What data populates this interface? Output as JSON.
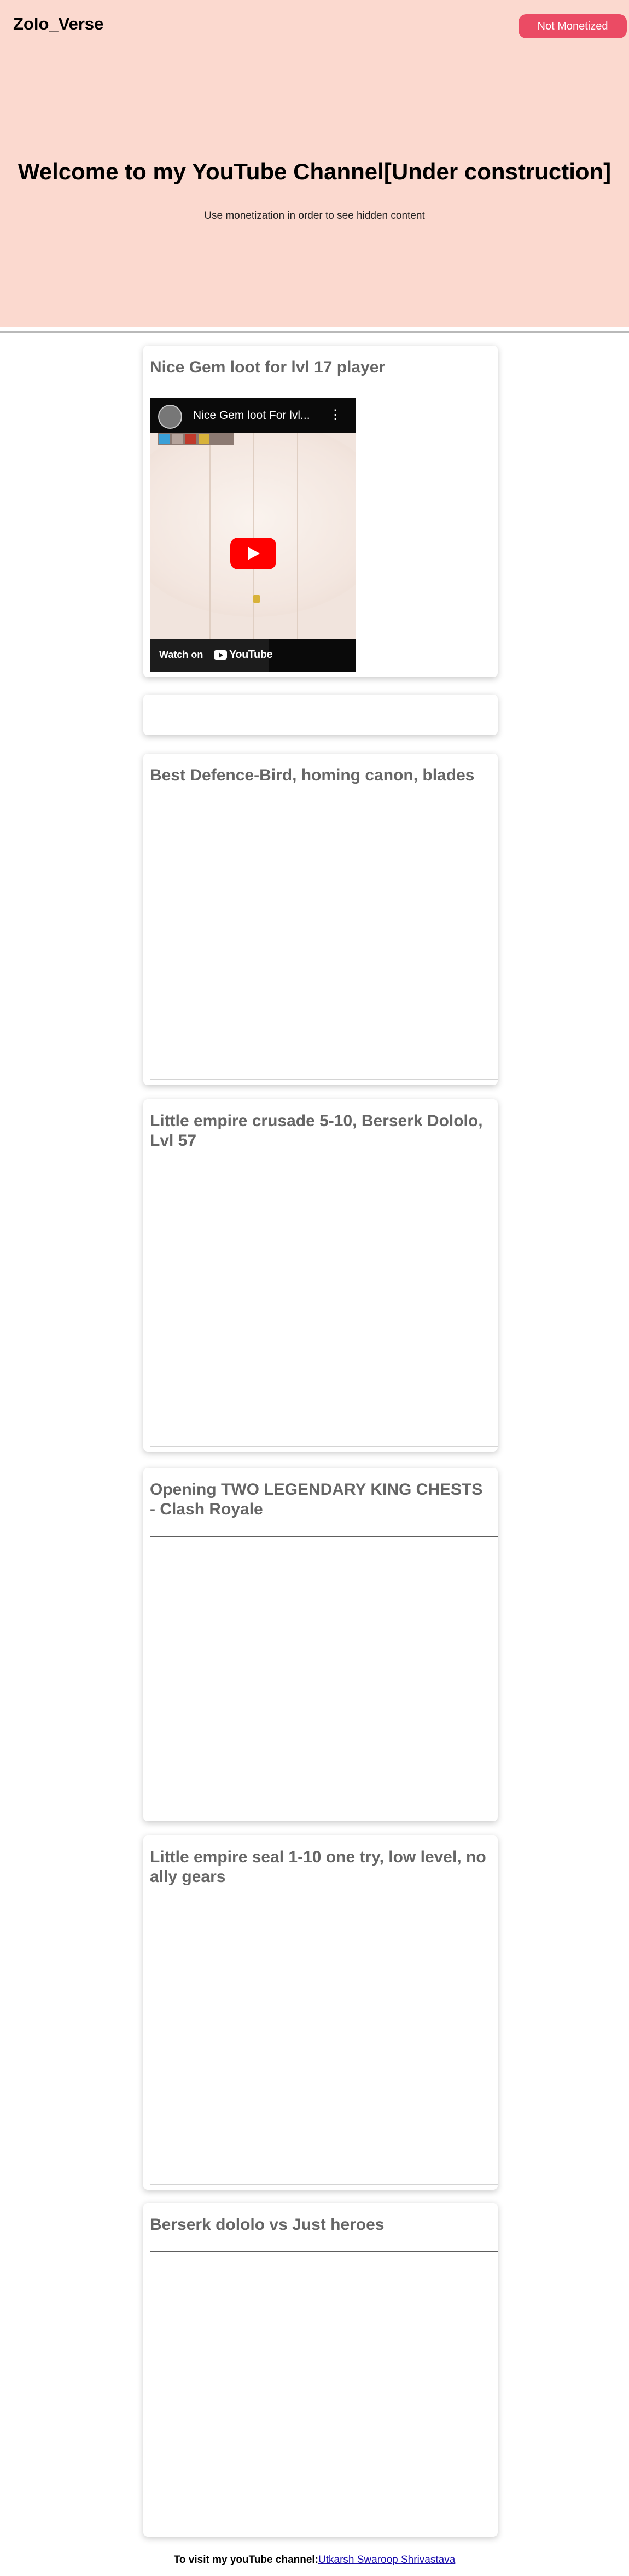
{
  "header": {
    "brand": "Zolo_Verse",
    "status_button": "Not Monetized"
  },
  "hero": {
    "title": "Welcome to my YouTube Channel[Under construction]",
    "subtitle": "Use monetization in order to see hidden content"
  },
  "videos": [
    {
      "title": "Nice Gem loot for lvl 17 player",
      "player": {
        "video_title": "Nice Gem loot For lvl...",
        "watch_on": "Watch on",
        "brand": "YouTube"
      }
    },
    {
      "title": ""
    },
    {
      "title": "Best Defence-Bird, homing canon, blades"
    },
    {
      "title": "Little empire crusade 5-10, Berserk Dololo, Lvl 57"
    },
    {
      "title": "Opening TWO LEGENDARY KING CHESTS - Clash Royale"
    },
    {
      "title": "Little empire seal 1-10 one try, low level, no ally gears"
    },
    {
      "title": "Berserk dololo vs Just heroes"
    }
  ],
  "footer": {
    "prefix": "To visit my youTube channel:",
    "link_text": "Utkarsh Swaroop Shrivastava"
  },
  "colors": {
    "hero_bg": "#fbd9cf",
    "button_bg": "#eb4b64",
    "card_title": "#666666",
    "youtube_red": "#ff0000"
  }
}
